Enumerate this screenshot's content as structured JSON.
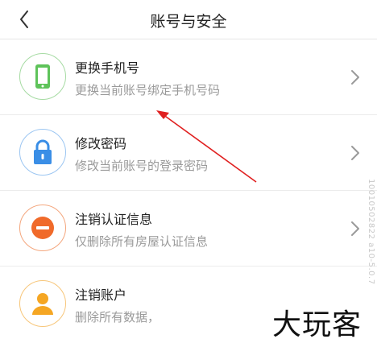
{
  "header": {
    "title": "账号与安全",
    "back_icon": "chevron-left-icon"
  },
  "items": [
    {
      "title": "更换手机号",
      "subtitle": "更换当前账号绑定手机号码",
      "icon": "phone-icon",
      "color": "#5ec35a"
    },
    {
      "title": "修改密码",
      "subtitle": "修改当前账号的登录密码",
      "icon": "lock-icon",
      "color": "#3a8ee6"
    },
    {
      "title": "注销认证信息",
      "subtitle": "仅删除所有房屋认证信息",
      "icon": "minus-circle-icon",
      "color": "#f06a2a"
    },
    {
      "title": "注销账户",
      "subtitle": "删除所有数据，",
      "icon": "user-icon",
      "color": "#f5a623"
    }
  ],
  "watermark": {
    "side_text": "10010502822 a10-5.0.7",
    "brand": "大玩客"
  },
  "annotation": {
    "arrow_color": "#e02020"
  }
}
